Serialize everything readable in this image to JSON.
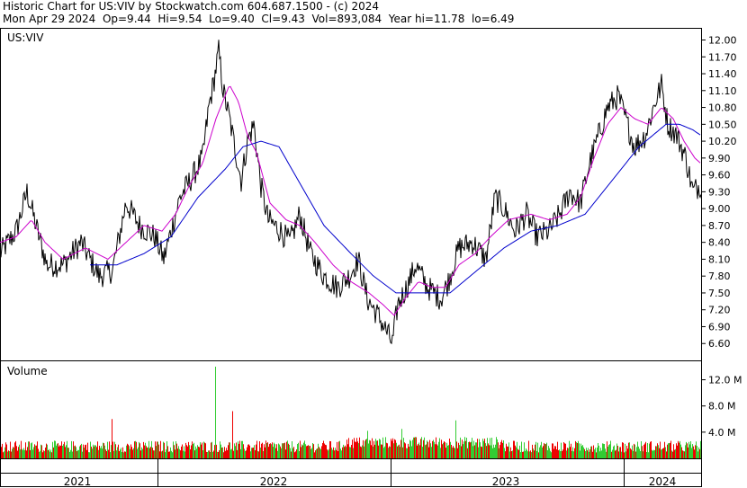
{
  "header": {
    "line1": "Historic Chart for US:VIV by Stockwatch.com 604.687.1500 - (c) 2024",
    "line2": "Mon Apr 29 2024  Op=9.44  Hi=9.54  Lo=9.40  Cl=9.43  Vol=893,084  Year hi=11.78  lo=6.49"
  },
  "chart_data": [
    {
      "type": "line",
      "title": "US:VIV",
      "y_axis_position": "right",
      "ylim": [
        6.3,
        12.2
      ],
      "y_ticks": [
        "12.00",
        "11.70",
        "11.40",
        "11.10",
        "10.80",
        "10.50",
        "10.20",
        "9.90",
        "9.60",
        "9.30",
        "9.00",
        "8.70",
        "8.40",
        "8.10",
        "7.80",
        "7.50",
        "7.20",
        "6.90",
        "6.60"
      ],
      "x_labels": [
        "2021",
        "2022",
        "2023",
        "2024"
      ],
      "grid": false,
      "series": [
        {
          "role": "price",
          "color": "#000000",
          "anchors": [
            [
              0,
              8.2
            ],
            [
              18,
              8.6
            ],
            [
              30,
              9.3
            ],
            [
              40,
              8.7
            ],
            [
              52,
              8.0
            ],
            [
              70,
              8.0
            ],
            [
              90,
              8.4
            ],
            [
              110,
              7.8
            ],
            [
              125,
              7.9
            ],
            [
              140,
              9.1
            ],
            [
              155,
              8.7
            ],
            [
              172,
              8.5
            ],
            [
              182,
              8.1
            ],
            [
              190,
              8.6
            ],
            [
              200,
              9.2
            ],
            [
              215,
              9.6
            ],
            [
              225,
              9.9
            ],
            [
              232,
              10.8
            ],
            [
              238,
              11.3
            ],
            [
              243,
              11.8
            ],
            [
              248,
              11.1
            ],
            [
              255,
              10.6
            ],
            [
              262,
              10.0
            ],
            [
              268,
              9.5
            ],
            [
              275,
              10.2
            ],
            [
              282,
              10.5
            ],
            [
              290,
              9.4
            ],
            [
              298,
              8.8
            ],
            [
              312,
              8.6
            ],
            [
              322,
              8.4
            ],
            [
              333,
              8.9
            ],
            [
              345,
              8.2
            ],
            [
              360,
              7.8
            ],
            [
              375,
              7.6
            ],
            [
              388,
              7.8
            ],
            [
              398,
              8.1
            ],
            [
              408,
              7.4
            ],
            [
              420,
              7.1
            ],
            [
              430,
              6.8
            ],
            [
              436,
              6.6
            ],
            [
              442,
              7.3
            ],
            [
              452,
              7.6
            ],
            [
              462,
              8.0
            ],
            [
              475,
              7.6
            ],
            [
              490,
              7.4
            ],
            [
              498,
              7.7
            ],
            [
              510,
              8.3
            ],
            [
              525,
              8.4
            ],
            [
              540,
              8.1
            ],
            [
              550,
              9.2
            ],
            [
              560,
              9.0
            ],
            [
              572,
              8.6
            ],
            [
              585,
              8.9
            ],
            [
              597,
              8.5
            ],
            [
              610,
              8.6
            ],
            [
              622,
              8.9
            ],
            [
              633,
              9.3
            ],
            [
              645,
              9.1
            ],
            [
              655,
              9.8
            ],
            [
              665,
              10.3
            ],
            [
              675,
              10.8
            ],
            [
              687,
              11.0
            ],
            [
              697,
              10.5
            ],
            [
              705,
              10.1
            ],
            [
              717,
              10.3
            ],
            [
              728,
              10.9
            ],
            [
              735,
              11.2
            ],
            [
              742,
              10.5
            ],
            [
              752,
              10.3
            ],
            [
              762,
              9.9
            ],
            [
              770,
              9.3
            ],
            [
              776,
              9.4
            ],
            [
              779,
              9.43
            ]
          ]
        },
        {
          "role": "short moving average",
          "color": "#cc00cc",
          "anchors": [
            [
              0,
              8.4
            ],
            [
              18,
              8.5
            ],
            [
              35,
              8.8
            ],
            [
              50,
              8.4
            ],
            [
              70,
              8.1
            ],
            [
              95,
              8.3
            ],
            [
              120,
              8.1
            ],
            [
              140,
              8.4
            ],
            [
              160,
              8.7
            ],
            [
              180,
              8.6
            ],
            [
              195,
              8.9
            ],
            [
              210,
              9.4
            ],
            [
              225,
              9.8
            ],
            [
              240,
              10.6
            ],
            [
              255,
              11.2
            ],
            [
              265,
              10.9
            ],
            [
              275,
              10.3
            ],
            [
              285,
              10.0
            ],
            [
              300,
              9.1
            ],
            [
              318,
              8.8
            ],
            [
              333,
              8.7
            ],
            [
              350,
              8.4
            ],
            [
              370,
              8.0
            ],
            [
              390,
              7.7
            ],
            [
              410,
              7.5
            ],
            [
              425,
              7.3
            ],
            [
              438,
              7.1
            ],
            [
              450,
              7.4
            ],
            [
              465,
              7.7
            ],
            [
              480,
              7.6
            ],
            [
              495,
              7.6
            ],
            [
              510,
              8.0
            ],
            [
              528,
              8.2
            ],
            [
              545,
              8.5
            ],
            [
              565,
              8.8
            ],
            [
              590,
              8.9
            ],
            [
              610,
              8.8
            ],
            [
              630,
              8.9
            ],
            [
              645,
              9.2
            ],
            [
              660,
              9.9
            ],
            [
              675,
              10.5
            ],
            [
              690,
              10.8
            ],
            [
              705,
              10.6
            ],
            [
              720,
              10.5
            ],
            [
              735,
              10.8
            ],
            [
              748,
              10.6
            ],
            [
              760,
              10.2
            ],
            [
              772,
              9.9
            ],
            [
              779,
              9.8
            ]
          ]
        },
        {
          "role": "long moving average",
          "color": "#0000cc",
          "anchors": [
            [
              100,
              8.0
            ],
            [
              130,
              8.0
            ],
            [
              160,
              8.2
            ],
            [
              190,
              8.5
            ],
            [
              220,
              9.2
            ],
            [
              250,
              9.7
            ],
            [
              270,
              10.1
            ],
            [
              290,
              10.2
            ],
            [
              310,
              10.1
            ],
            [
              335,
              9.4
            ],
            [
              360,
              8.7
            ],
            [
              390,
              8.2
            ],
            [
              415,
              7.8
            ],
            [
              440,
              7.5
            ],
            [
              470,
              7.5
            ],
            [
              500,
              7.5
            ],
            [
              530,
              7.9
            ],
            [
              560,
              8.3
            ],
            [
              590,
              8.6
            ],
            [
              620,
              8.7
            ],
            [
              650,
              8.9
            ],
            [
              680,
              9.5
            ],
            [
              710,
              10.1
            ],
            [
              740,
              10.5
            ],
            [
              755,
              10.5
            ],
            [
              770,
              10.4
            ],
            [
              779,
              10.3
            ]
          ]
        }
      ]
    },
    {
      "type": "bar",
      "title": "Volume",
      "y_axis_position": "right",
      "ylim": [
        0,
        14000000
      ],
      "y_ticks": [
        "12.0 M",
        "8.0 M",
        "4.0 M"
      ],
      "colors": {
        "up": "#33cc33",
        "down": "#ee0000"
      },
      "spikes": [
        {
          "x": 124,
          "value": 6000000,
          "up": false
        },
        {
          "x": 239,
          "value": 14000000,
          "up": true
        },
        {
          "x": 258,
          "value": 7200000,
          "up": false
        },
        {
          "x": 408,
          "value": 4200000,
          "up": true
        },
        {
          "x": 446,
          "value": 4500000,
          "up": true
        },
        {
          "x": 506,
          "value": 5800000,
          "up": true
        }
      ]
    }
  ]
}
